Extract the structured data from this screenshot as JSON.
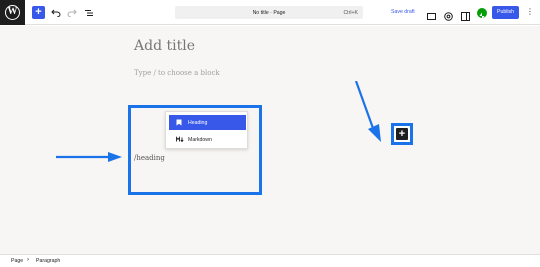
{
  "toolbar": {
    "logo_letter": "W",
    "inserter_symbol": "+",
    "doc_title": "No title · Page",
    "doc_shortcut": "Ctrl+K",
    "save_draft": "Save draft",
    "publish": "Publish",
    "more_symbol": "⋮"
  },
  "editor": {
    "title_placeholder": "Add title",
    "block_hint": "Type / to choose a block",
    "slash_command": "/heading"
  },
  "popup": {
    "items": [
      {
        "label": "Heading",
        "icon": "bookmark-icon",
        "selected": true
      },
      {
        "label": "Markdown",
        "icon": "markdown-icon",
        "selected": false
      }
    ]
  },
  "block_inserter_symbol": "+",
  "breadcrumb": {
    "page": "Page",
    "separator": "›",
    "current": "Paragraph"
  },
  "colors": {
    "accent": "#3858e9",
    "annotation": "#1a73e8",
    "canvas": "#f8f6f4"
  }
}
